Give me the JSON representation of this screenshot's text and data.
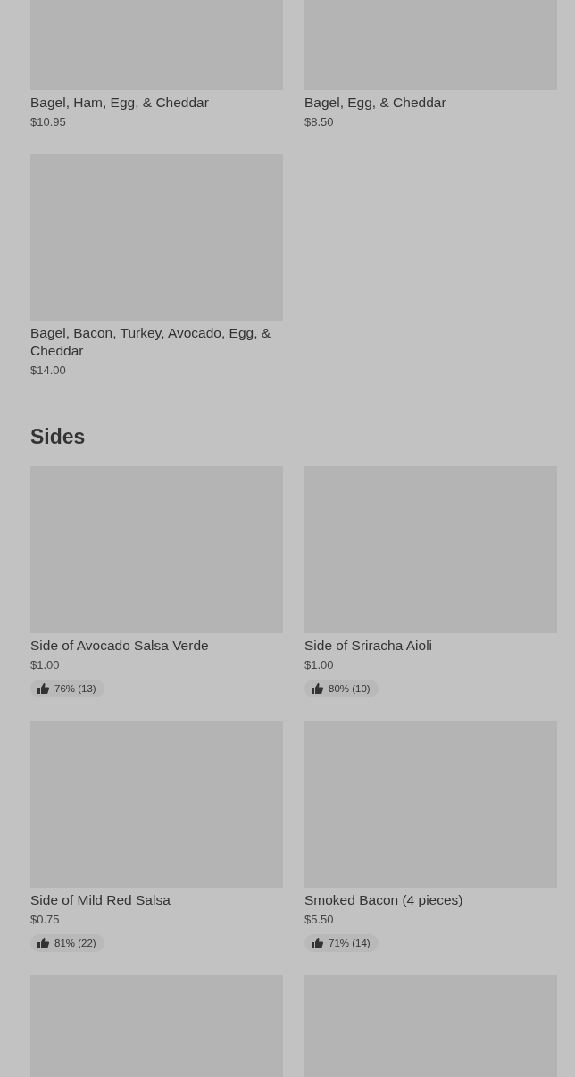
{
  "sections": [
    {
      "items": [
        {
          "kind": "item",
          "name": "Bagel, Ham, Egg, & Cheddar",
          "price": "$10.95"
        },
        {
          "kind": "item",
          "name": "Bagel, Egg, & Cheddar",
          "price": "$8.50"
        },
        {
          "kind": "item",
          "name": "Bagel, Bacon, Turkey, Avocado, Egg, & Cheddar",
          "price": "$14.00"
        }
      ]
    },
    {
      "title": "Sides",
      "items": [
        {
          "kind": "item",
          "name": "Side of Avocado Salsa Verde",
          "price": "$1.00",
          "rating": "76% (13)"
        },
        {
          "kind": "item",
          "name": "Side of Sriracha Aioli",
          "price": "$1.00",
          "rating": "80% (10)"
        },
        {
          "kind": "item",
          "name": "Side of Mild Red Salsa",
          "price": "$0.75",
          "rating": "81% (22)"
        },
        {
          "kind": "item",
          "name": "Smoked Bacon (4 pieces)",
          "price": "$5.50",
          "rating": "71% (14)"
        },
        {
          "kind": "image_only"
        },
        {
          "kind": "image_only"
        }
      ]
    }
  ]
}
